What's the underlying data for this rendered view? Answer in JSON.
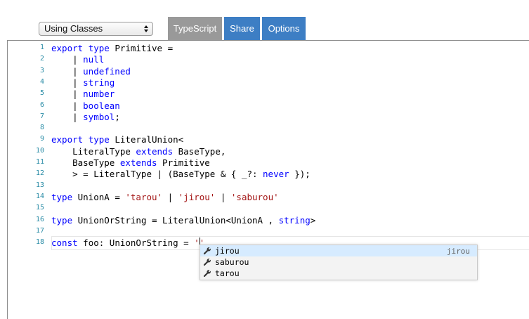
{
  "toolbar": {
    "example_select": "Using Classes",
    "tabs": [
      {
        "label": "TypeScript",
        "active": true
      },
      {
        "label": "Share"
      },
      {
        "label": "Options"
      }
    ]
  },
  "editor": {
    "lines": [
      {
        "n": "1",
        "tokens": [
          [
            "kw",
            "export"
          ],
          [
            "p",
            " "
          ],
          [
            "kw",
            "type"
          ],
          [
            "p",
            " Primitive ="
          ]
        ]
      },
      {
        "n": "2",
        "tokens": [
          [
            "p",
            "    | "
          ],
          [
            "kw",
            "null"
          ]
        ]
      },
      {
        "n": "3",
        "tokens": [
          [
            "p",
            "    | "
          ],
          [
            "kw",
            "undefined"
          ]
        ]
      },
      {
        "n": "4",
        "tokens": [
          [
            "p",
            "    | "
          ],
          [
            "kw",
            "string"
          ]
        ]
      },
      {
        "n": "5",
        "tokens": [
          [
            "p",
            "    | "
          ],
          [
            "kw",
            "number"
          ]
        ]
      },
      {
        "n": "6",
        "tokens": [
          [
            "p",
            "    | "
          ],
          [
            "kw",
            "boolean"
          ]
        ]
      },
      {
        "n": "7",
        "tokens": [
          [
            "p",
            "    | "
          ],
          [
            "kw",
            "symbol"
          ],
          [
            "p",
            ";"
          ]
        ]
      },
      {
        "n": "8",
        "tokens": []
      },
      {
        "n": "9",
        "tokens": [
          [
            "kw",
            "export"
          ],
          [
            "p",
            " "
          ],
          [
            "kw",
            "type"
          ],
          [
            "p",
            " LiteralUnion<"
          ]
        ]
      },
      {
        "n": "10",
        "tokens": [
          [
            "p",
            "    LiteralType "
          ],
          [
            "kw",
            "extends"
          ],
          [
            "p",
            " BaseType,"
          ]
        ]
      },
      {
        "n": "11",
        "tokens": [
          [
            "p",
            "    BaseType "
          ],
          [
            "kw",
            "extends"
          ],
          [
            "p",
            " Primitive"
          ]
        ]
      },
      {
        "n": "12",
        "tokens": [
          [
            "p",
            "    > = LiteralType | (BaseType & { _?: "
          ],
          [
            "kw",
            "never"
          ],
          [
            "p",
            " });"
          ]
        ]
      },
      {
        "n": "13",
        "tokens": []
      },
      {
        "n": "14",
        "tokens": [
          [
            "kw",
            "type"
          ],
          [
            "p",
            " UnionA = "
          ],
          [
            "str",
            "'tarou'"
          ],
          [
            "p",
            " | "
          ],
          [
            "str",
            "'jirou'"
          ],
          [
            "p",
            " | "
          ],
          [
            "str",
            "'saburou'"
          ]
        ]
      },
      {
        "n": "15",
        "tokens": []
      },
      {
        "n": "16",
        "tokens": [
          [
            "kw",
            "type"
          ],
          [
            "p",
            " UnionOrString = LiteralUnion<UnionA , "
          ],
          [
            "kw",
            "string"
          ],
          [
            "p",
            ">"
          ]
        ]
      },
      {
        "n": "17",
        "tokens": []
      },
      {
        "n": "18",
        "tokens": [
          [
            "kw",
            "const"
          ],
          [
            "p",
            " foo: UnionOrString = "
          ],
          [
            "str",
            "''"
          ]
        ]
      }
    ]
  },
  "suggest": {
    "items": [
      {
        "label": "jirou",
        "detail": "jirou",
        "selected": true
      },
      {
        "label": "saburou",
        "detail": ""
      },
      {
        "label": "tarou",
        "detail": ""
      }
    ]
  }
}
